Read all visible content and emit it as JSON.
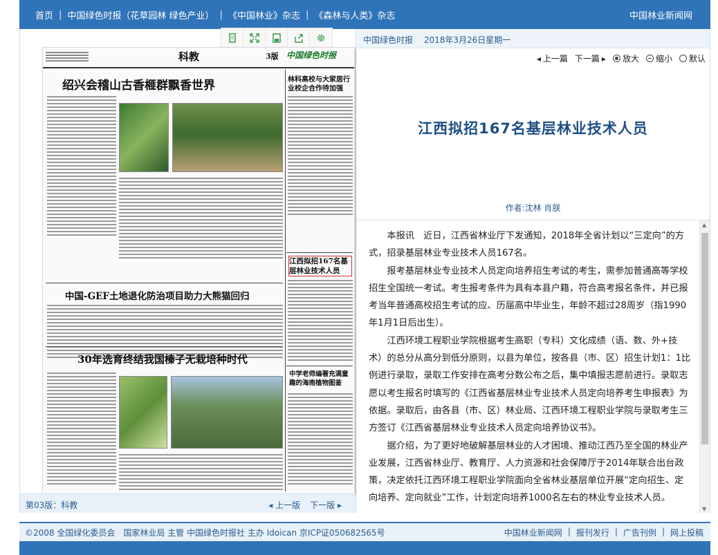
{
  "topnav": {
    "items": [
      "首页",
      "中国绿色时报（花草园林 绿色产业）",
      "《中国林业》杂志",
      "《森林与人类》杂志"
    ],
    "brand": "中国林业新闻网"
  },
  "toolbar": {
    "icons": [
      "page-icon",
      "fullscreen-icon",
      "save-icon",
      "share-icon",
      "settings-icon"
    ]
  },
  "newspaper": {
    "section": "科教",
    "edition": "3版",
    "masthead": "中国绿色时报",
    "headlines": [
      "绍兴会稽山古香榧群飘香世界",
      "林科高校与大家居行业校企合作待加强",
      "中国-GEF土地退化防治项目助力大熊猫回归",
      "江西拟招167名基层林业技术人员",
      "30年选育终结我国榛子无栽培种时代",
      "中学老师编著充满童趣的海南植物图鉴"
    ]
  },
  "left_footer": {
    "version": "第03版：科教",
    "prev": "上一版",
    "next": "下一版"
  },
  "right_panel": {
    "paper_name": "中国绿色时报",
    "date": "2018年3月26日星期一",
    "controls": {
      "prev": "上一篇",
      "next": "下一篇",
      "zoom_in": "放大",
      "zoom_out": "缩小",
      "default": "默认"
    },
    "title": "江西拟招167名基层林业技术人员",
    "author": "作者:沈林  肖朕",
    "paragraphs": [
      "本报讯　近日，江西省林业厅下发通知，2018年全省计划以“三定向”的方式，招录基层林业专业技术人员167名。",
      "报考基层林业专业技术人员定向培养招生考试的考生，需参加普通高等学校招生全国统一考试。考生报考条件为具有本县户籍，符合高考报名条件，并已报考当年普通高校招生考试的应、历届高中毕业生，年龄不超过28周岁（指1990年1月1日后出生）。",
      "江西环境工程职业学院根据考生高职（专科）文化成绩（语、数、外+技术）的总分从高分到低分原则，以县为单位，按各县（市、区）招生计划1：1比例进行录取，录取工作安排在高考分数公布之后，集中填报志愿前进行。录取志愿以考生报名时填写的《江西省基层林业专业技术人员定向培养考生申报表》为依据。录取后，由各县（市、区）林业局、江西环境工程职业学院与录取考生三方签订《江西省基层林业专业技术人员定向培养协议书》。",
      "据介绍，为了更好地破解基层林业的人才困境、推动江西乃至全国的林业产业发展，江西省林业厅、教育厅、人力资源和社会保障厅于2014年联合出台政策，决定依托江西环境工程职业学院面向全省林业基层单位开展“定向招生、定向培养、定向就业”工作，计划定向培养1000名左右的林业专业技术人员。"
    ]
  },
  "footer": {
    "copyright": "©2008 全国绿化委员会　国家林业局 主管 中国绿色时报社 主办 Idoican 京ICP证050682565号",
    "links": [
      "中国林业新闻网",
      "报刊发行",
      "广告刊例",
      "网上投稿"
    ]
  },
  "colors": {
    "nav_blue": "#2f73b8",
    "title_blue": "#1e4f86",
    "link_blue": "#2a5c8e",
    "panel_bg": "#e8f0f8"
  }
}
